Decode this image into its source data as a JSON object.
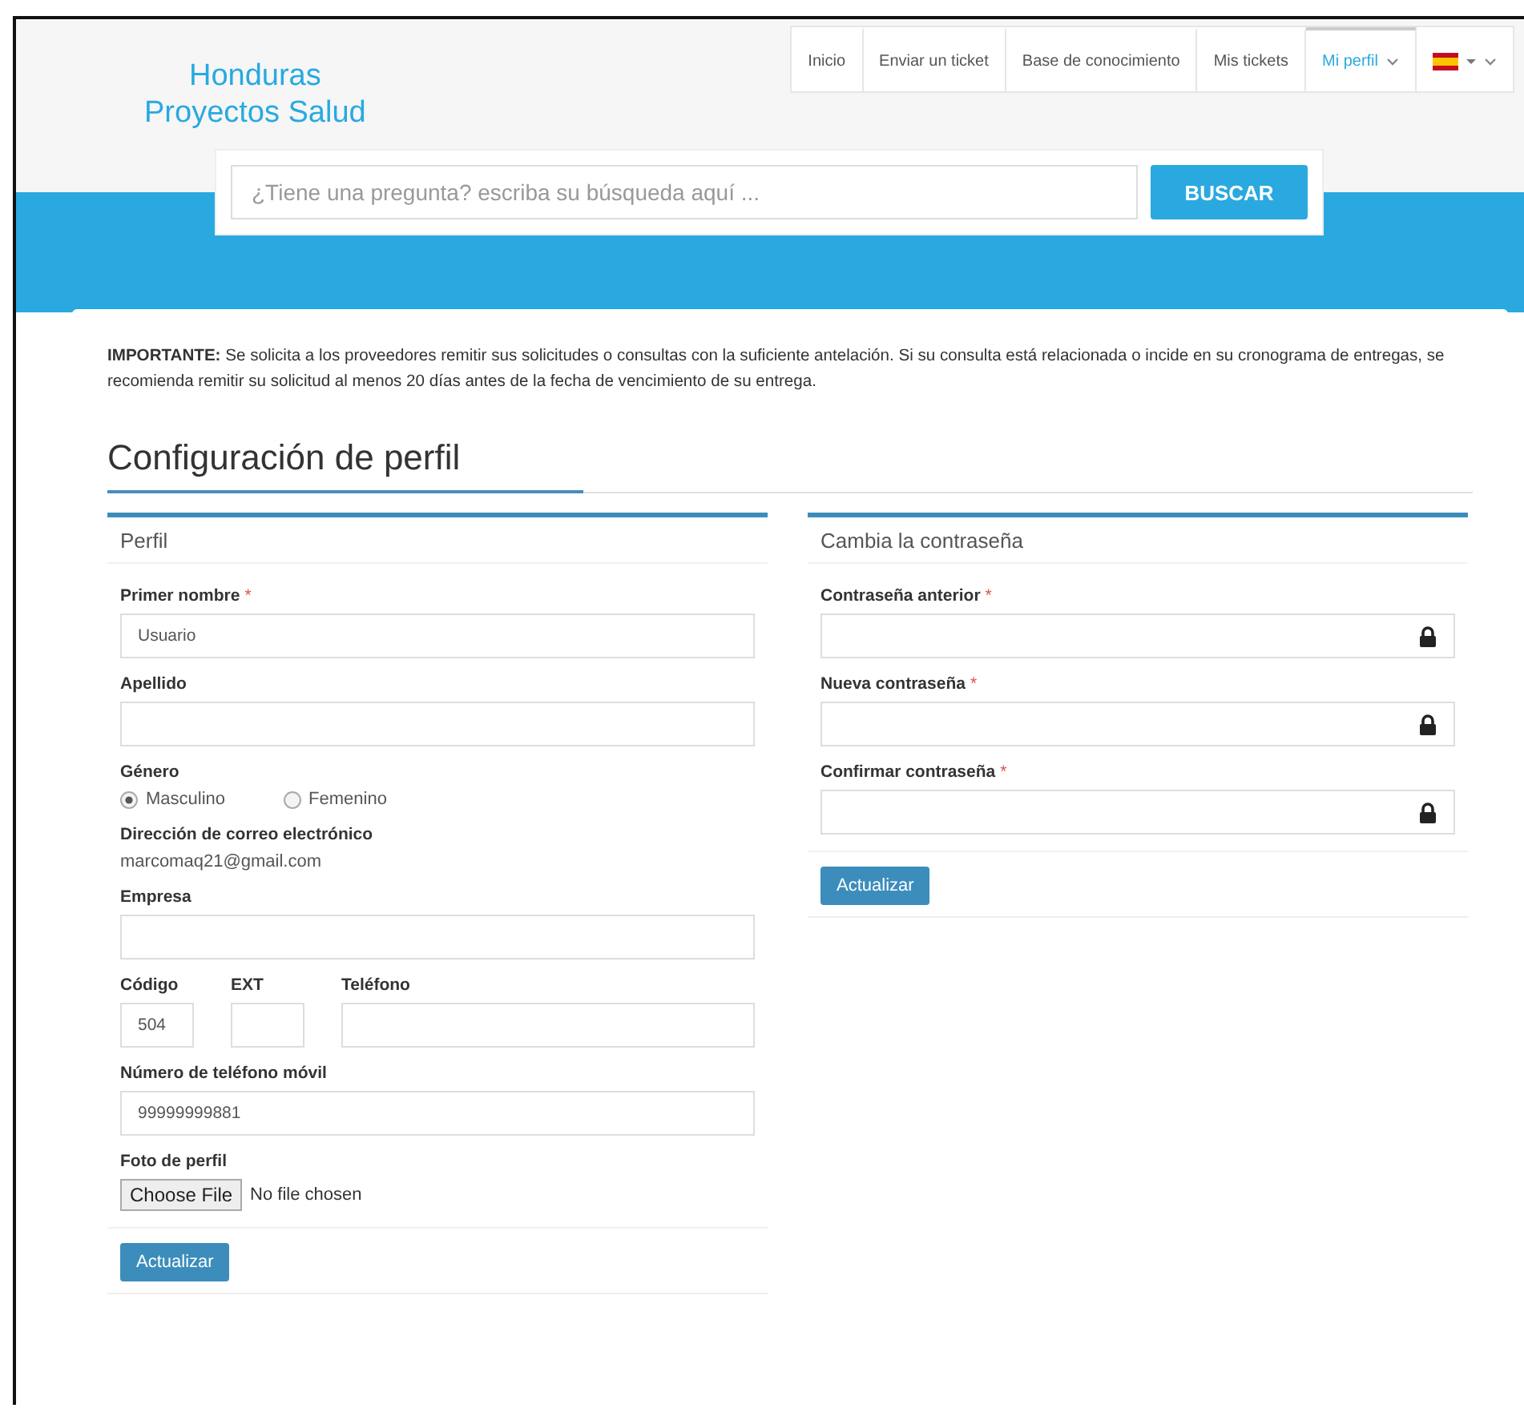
{
  "logo": {
    "lines": [
      "Honduras",
      "Proyectos Salud"
    ]
  },
  "nav": [
    {
      "kind": "link",
      "label": "Inicio",
      "selected": false
    },
    {
      "kind": "link",
      "label": "Enviar un ticket",
      "selected": false
    },
    {
      "kind": "link",
      "label": "Base de conocimiento",
      "selected": false
    },
    {
      "kind": "link",
      "label": "Mis tickets",
      "selected": false
    },
    {
      "kind": "menu",
      "label": "Mi perfil",
      "selected": true
    },
    {
      "kind": "flag",
      "selected": false
    }
  ],
  "search": {
    "placeholder": "¿Tiene una pregunta? escriba su búsqueda aquí ...",
    "button": "BUSCAR"
  },
  "notice": "**IMPORTANTE:** Se solicita a los proveedores remitir sus solicitudes o consultas con la suficiente antelación. Si su consulta está relacionada o incide en su cronograma de entregas, se recomienda remitir su solicitud al menos 20 días antes de la fecha de vencimiento de su entrega.",
  "page_title": "Configuración de perfil",
  "panels": [
    {
      "title": "Perfil",
      "button": "Actualizar",
      "fields": [
        {
          "kind": "text",
          "label": "Primer nombre",
          "required_mark": "*",
          "value": "Usuario"
        },
        {
          "kind": "text",
          "label": "Apellido"
        },
        {
          "kind": "radio",
          "label": "Género",
          "options": [
            {
              "label": "Masculino",
              "selected": true
            },
            {
              "label": "Femenino",
              "selected": false
            }
          ]
        },
        {
          "kind": "static",
          "label": "Dirección de correo electrónico",
          "value": "marcomaq21@gmail.com"
        },
        {
          "kind": "text",
          "label": "Empresa"
        },
        {
          "kind": "row",
          "parts": [
            {
              "label": "Código",
              "value": "504"
            },
            {
              "label": "EXT"
            },
            {
              "label": "Teléfono"
            }
          ]
        },
        {
          "kind": "text",
          "label": "Número de teléfono móvil",
          "value": "99999999881"
        },
        {
          "kind": "file",
          "label": "Foto de perfil",
          "button": "Choose File",
          "status": "No file chosen"
        }
      ]
    },
    {
      "title": "Cambia la contraseña",
      "button": "Actualizar",
      "fields": [
        {
          "kind": "password",
          "label": "Contraseña anterior",
          "required_mark": "*"
        },
        {
          "kind": "password",
          "label": "Nueva contraseña",
          "required_mark": "*"
        },
        {
          "kind": "password",
          "label": "Confirmar contraseña",
          "required_mark": "*"
        }
      ]
    }
  ]
}
